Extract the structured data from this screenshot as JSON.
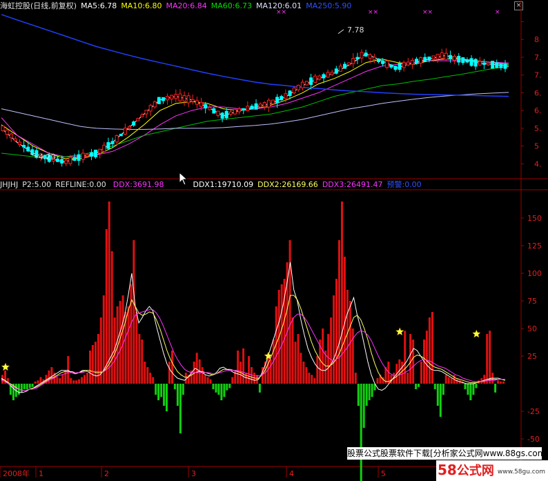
{
  "header": {
    "stock_label": "海虹控股(日线,前复权)",
    "ma5": "MA5:6.78",
    "ma10": "MA10:6.80",
    "ma20": "MA20:6.84",
    "ma60": "MA60:6.73",
    "ma120": "MA120:6.01",
    "ma250": "MA250:5.90",
    "close_glyph": "×"
  },
  "indicator_header": {
    "name": "JHJHJ",
    "p2": "P2:5.00",
    "refline": "REFLINE:0.00",
    "ddx": "DDX:3691.98",
    "ddx1": "DDX1:19710.09",
    "ddx2": "DDX2:26169.66",
    "ddx3": "DDX3:26491.47",
    "alert": "预警:0.00"
  },
  "price_annotations": {
    "high": "7.78",
    "low": "4.20",
    "x_marks": [
      "××",
      "××",
      "×"
    ]
  },
  "price_axis_ticks": [
    "8",
    "7.",
    "7.",
    "6.",
    "6.",
    "5.",
    "5",
    "4."
  ],
  "indicator_axis_ticks": [
    "150",
    "125",
    "100",
    "75",
    "50",
    "25",
    "-25",
    "-50"
  ],
  "date_axis": [
    "2008年",
    "1",
    "2",
    "3",
    "4",
    "5"
  ],
  "watermark": {
    "text": "股票公式股票软件下载[分析家公式网www.88gs.com]"
  },
  "logo": {
    "num1": "58",
    "num2": "",
    "cn": "公式网",
    "url": "www.58gu.com"
  },
  "colors": {
    "up": "#ff2020",
    "down": "#00ffff",
    "bar_up": "#e01010",
    "bar_down": "#10d010",
    "ma5": "#ffffff",
    "ma10": "#ffff00",
    "ma20": "#ff33ff",
    "ma60": "#00c000",
    "ma120": "#c0c0ff",
    "ma250": "#2040ff",
    "grid": "#a00000",
    "star": "#ffff40"
  },
  "chart_data": [
    {
      "type": "candlestick",
      "title": "海虹控股(日线,前复权)",
      "ylim": [
        3.6,
        8.3
      ],
      "y_ticks": [
        4,
        4.5,
        5,
        5.5,
        6,
        6.5,
        7,
        7.5,
        8
      ],
      "annotations": [
        {
          "label": "7.78",
          "value": 7.78
        },
        {
          "label": "4.20",
          "value": 4.2
        }
      ],
      "series": [
        {
          "name": "MA5",
          "values": [
            5.0,
            4.6,
            4.3,
            4.15,
            4.05,
            4.2,
            4.3,
            4.6,
            5.0,
            5.4,
            5.8,
            5.9,
            5.8,
            5.6,
            5.35,
            5.5,
            5.6,
            5.7,
            5.9,
            6.2,
            6.4,
            6.55,
            6.8,
            7.1,
            6.9,
            6.7,
            6.85,
            6.95,
            7.05,
            6.95,
            6.85,
            6.8,
            6.75
          ]
        },
        {
          "name": "MA10",
          "values": [
            5.1,
            4.8,
            4.5,
            4.3,
            4.15,
            4.15,
            4.25,
            4.45,
            4.75,
            5.1,
            5.5,
            5.7,
            5.75,
            5.7,
            5.55,
            5.5,
            5.55,
            5.65,
            5.8,
            6.0,
            6.25,
            6.4,
            6.6,
            6.85,
            6.95,
            6.85,
            6.8,
            6.9,
            6.95,
            6.95,
            6.9,
            6.85,
            6.8
          ]
        },
        {
          "name": "MA20",
          "values": [
            5.3,
            4.8,
            4.55,
            4.3,
            4.2,
            4.2,
            4.25,
            4.35,
            4.55,
            4.8,
            5.1,
            5.35,
            5.5,
            5.6,
            5.6,
            5.55,
            5.55,
            5.6,
            5.7,
            5.85,
            6.0,
            6.2,
            6.4,
            6.6,
            6.75,
            6.8,
            6.85,
            6.9,
            6.9,
            6.9,
            6.88,
            6.86,
            6.84
          ]
        },
        {
          "name": "MA60",
          "values": [
            4.3,
            4.25,
            4.2,
            4.18,
            4.2,
            4.25,
            4.35,
            4.5,
            4.65,
            4.8,
            4.9,
            5.0,
            5.1,
            5.2,
            5.25,
            5.3,
            5.35,
            5.4,
            5.5,
            5.6,
            5.75,
            5.9,
            6.0,
            6.1,
            6.2,
            6.25,
            6.32,
            6.38,
            6.45,
            6.52,
            6.6,
            6.68,
            6.73
          ]
        },
        {
          "name": "MA120",
          "values": [
            5.55,
            5.45,
            5.35,
            5.25,
            5.15,
            5.05,
            5.0,
            4.98,
            4.97,
            4.97,
            4.98,
            5.0,
            5.0,
            5.0,
            5.02,
            5.05,
            5.08,
            5.12,
            5.18,
            5.25,
            5.35,
            5.45,
            5.55,
            5.62,
            5.7,
            5.76,
            5.82,
            5.87,
            5.91,
            5.94,
            5.97,
            5.99,
            6.01
          ]
        },
        {
          "name": "MA250",
          "values": [
            8.2,
            8.05,
            7.9,
            7.75,
            7.6,
            7.45,
            7.3,
            7.18,
            7.06,
            6.95,
            6.85,
            6.75,
            6.65,
            6.55,
            6.46,
            6.38,
            6.3,
            6.24,
            6.2,
            6.15,
            6.12,
            6.08,
            6.05,
            6.03,
            6.0,
            5.98,
            5.96,
            5.95,
            5.94,
            5.93,
            5.92,
            5.91,
            5.9
          ]
        }
      ]
    },
    {
      "type": "bar",
      "title": "JHJHJ",
      "ylim": [
        -70,
        175
      ],
      "y_ticks": [
        -50,
        -25,
        25,
        50,
        75,
        100,
        125,
        150
      ],
      "markers": [
        {
          "label": "star",
          "index": 1,
          "value": 15
        },
        {
          "label": "star",
          "index": 97,
          "value": 25
        },
        {
          "label": "star",
          "index": 145,
          "value": 47
        },
        {
          "label": "star",
          "index": 173,
          "value": 45
        }
      ],
      "values": [
        8,
        12,
        5,
        -10,
        -15,
        -12,
        -10,
        -8,
        -5,
        -5,
        -4,
        -3,
        2,
        3,
        6,
        4,
        8,
        12,
        15,
        10,
        6,
        5,
        8,
        12,
        25,
        5,
        3,
        3,
        4,
        6,
        8,
        10,
        30,
        35,
        38,
        45,
        60,
        80,
        140,
        165,
        120,
        60,
        70,
        75,
        80,
        65,
        70,
        90,
        130,
        65,
        45,
        40,
        20,
        15,
        10,
        6,
        -10,
        -15,
        -12,
        -20,
        -25,
        20,
        30,
        -5,
        -20,
        -45,
        -10,
        10,
        8,
        12,
        20,
        28,
        22,
        15,
        8,
        6,
        4,
        -5,
        -8,
        -10,
        -15,
        -12,
        -6,
        -4,
        6,
        12,
        30,
        20,
        32,
        10,
        25,
        15,
        10,
        8,
        -8,
        15,
        20,
        25,
        22,
        40,
        70,
        85,
        90,
        95,
        110,
        130,
        60,
        38,
        45,
        28,
        20,
        15,
        10,
        8,
        5,
        25,
        40,
        50,
        30,
        45,
        60,
        80,
        95,
        130,
        165,
        115,
        85,
        75,
        50,
        10,
        -20,
        -95,
        -40,
        -20,
        -15,
        -12,
        -6,
        5,
        8,
        6,
        15,
        20,
        8,
        10,
        18,
        22,
        20,
        48,
        10,
        45,
        40,
        -5,
        -3,
        20,
        40,
        48,
        60,
        65,
        -5,
        -20,
        -30,
        -10,
        8,
        6,
        5,
        8,
        4,
        3,
        2,
        -5,
        -10,
        -15,
        -10,
        -4,
        3,
        5,
        8,
        45,
        48,
        10,
        -8,
        3,
        2,
        2
      ],
      "series": [
        {
          "name": "DDX1",
          "values": [
            5,
            3,
            0,
            -3,
            -6,
            -8,
            -8,
            -7,
            -5,
            -4,
            -2,
            0,
            2,
            4,
            6,
            8,
            10,
            12,
            12,
            12,
            10,
            9,
            10,
            12,
            12,
            10,
            8,
            7,
            8,
            12,
            18,
            24,
            30,
            40,
            50,
            62,
            80,
            100,
            70,
            55,
            60,
            66,
            70,
            66,
            52,
            40,
            28,
            18,
            12,
            8,
            5,
            4,
            3,
            6,
            10,
            14,
            12,
            10,
            8,
            7,
            8,
            10,
            14,
            15,
            13,
            12,
            10,
            9,
            8,
            6,
            5,
            4,
            3,
            4,
            10,
            18,
            28,
            38,
            48,
            58,
            72,
            90,
            110,
            85,
            75,
            58,
            44,
            32,
            24,
            18,
            14,
            12,
            12,
            15,
            20,
            28,
            38,
            50,
            62,
            70,
            78,
            62,
            50,
            35,
            20,
            8,
            0,
            -5,
            -6,
            -4,
            0,
            4,
            8,
            12,
            16,
            20,
            26,
            32,
            30,
            25,
            20,
            16,
            13,
            12,
            12,
            11,
            9,
            7,
            5,
            3,
            2,
            1,
            0,
            0,
            0,
            1,
            2,
            3,
            4,
            5,
            5,
            5,
            4,
            3
          ]
        },
        {
          "name": "DDX2",
          "values": [
            4,
            3,
            1,
            -1,
            -3,
            -5,
            -6,
            -6,
            -5,
            -4,
            -3,
            -1,
            1,
            3,
            5,
            6,
            8,
            10,
            11,
            11,
            11,
            10,
            10,
            11,
            12,
            12,
            11,
            10,
            10,
            11,
            15,
            20,
            26,
            34,
            44,
            54,
            66,
            76,
            70,
            64,
            62,
            63,
            65,
            64,
            58,
            50,
            40,
            30,
            22,
            16,
            11,
            8,
            6,
            6,
            8,
            10,
            11,
            11,
            10,
            9,
            8,
            9,
            11,
            13,
            13,
            13,
            12,
            11,
            10,
            8,
            7,
            6,
            5,
            5,
            8,
            13,
            20,
            28,
            36,
            44,
            54,
            66,
            80,
            80,
            76,
            68,
            58,
            48,
            38,
            30,
            24,
            19,
            16,
            16,
            18,
            22,
            28,
            36,
            44,
            52,
            60,
            62,
            58,
            50,
            40,
            28,
            18,
            10,
            5,
            2,
            2,
            4,
            6,
            9,
            12,
            15,
            19,
            24,
            26,
            25,
            23,
            20,
            17,
            15,
            14,
            13,
            11,
            9,
            7,
            5,
            4,
            3,
            2,
            1,
            1,
            1,
            2,
            2,
            3,
            4,
            4,
            4,
            4,
            3
          ]
        },
        {
          "name": "DDX3",
          "values": [
            3,
            2,
            0,
            -2,
            -4,
            -5,
            -6,
            -6,
            -5,
            -5,
            -4,
            -2,
            0,
            2,
            4,
            5,
            7,
            8,
            9,
            10,
            10,
            10,
            10,
            10,
            11,
            11,
            11,
            11,
            11,
            11,
            13,
            16,
            20,
            26,
            32,
            40,
            48,
            56,
            62,
            64,
            65,
            66,
            67,
            67,
            64,
            59,
            52,
            44,
            36,
            28,
            22,
            17,
            13,
            11,
            10,
            10,
            10,
            10,
            10,
            10,
            9,
            9,
            10,
            11,
            12,
            12,
            12,
            12,
            11,
            10,
            9,
            8,
            7,
            7,
            8,
            10,
            14,
            19,
            25,
            31,
            38,
            46,
            54,
            60,
            63,
            63,
            60,
            55,
            49,
            43,
            37,
            31,
            26,
            23,
            21,
            22,
            24,
            28,
            32,
            37,
            42,
            46,
            48,
            47,
            44,
            39,
            32,
            25,
            19,
            14,
            10,
            8,
            7,
            8,
            9,
            11,
            13,
            16,
            19,
            21,
            22,
            21,
            20,
            18,
            16,
            15,
            14,
            12,
            10,
            8,
            7,
            5,
            4,
            3,
            2,
            2,
            2,
            2,
            3,
            3,
            3,
            4,
            4,
            4
          ]
        }
      ]
    }
  ]
}
